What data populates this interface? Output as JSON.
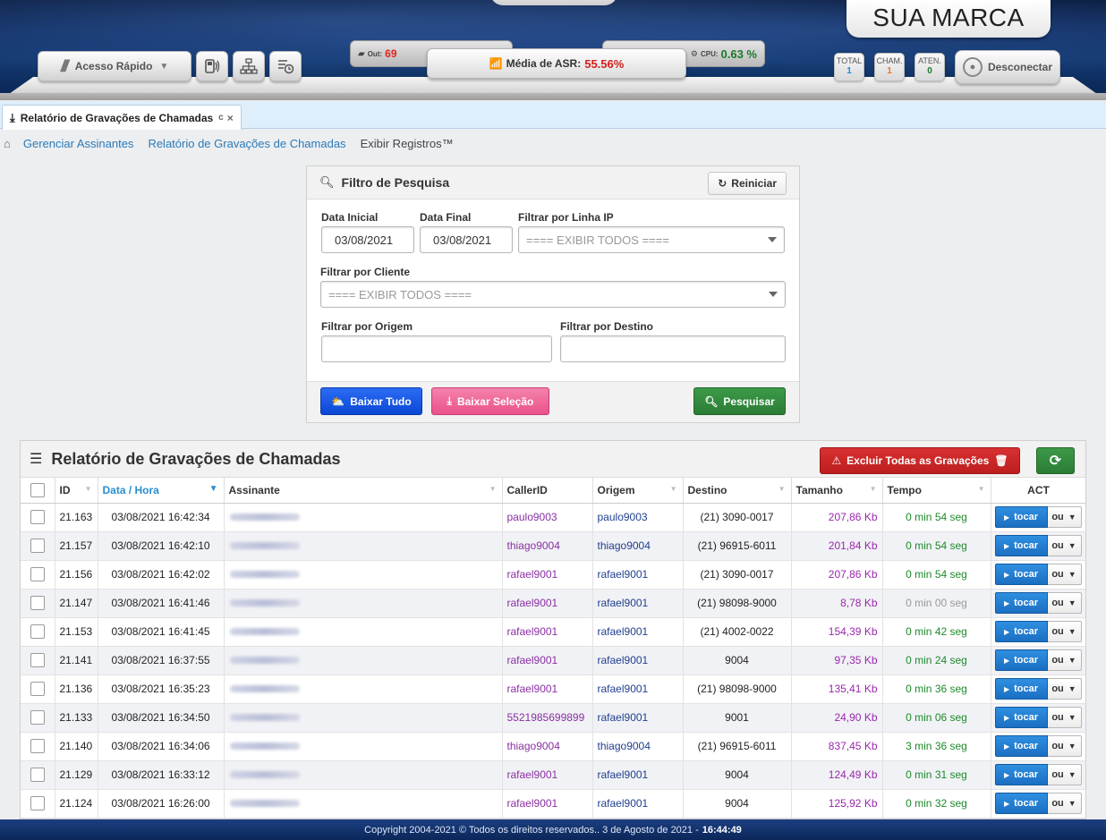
{
  "header": {
    "brand": "SUA MARCA",
    "quick_access": "Acesso Rápido",
    "stat_out_label": "Out:",
    "stat_out_value": "69",
    "asr_label": "Média de ASR:",
    "asr_value": "55.56%",
    "cpu_label": "CPU:",
    "cpu_value": "0.63 %",
    "counters": [
      {
        "label": "TOTAL",
        "value": "1"
      },
      {
        "label": "CHAM.",
        "value": "1"
      },
      {
        "label": "ATEN.",
        "value": "0"
      }
    ],
    "logout": "Desconectar"
  },
  "tab": {
    "label": "Relatório de Gravações de Chamadas",
    "refresh": "c",
    "close": "×"
  },
  "breadcrumb": {
    "items": [
      "Gerenciar Assinantes",
      "Relatório de Gravações de Chamadas"
    ],
    "current": "Exibir Registros™"
  },
  "filter": {
    "title": "Filtro de Pesquisa",
    "reset": "Reiniciar",
    "date_start_label": "Data Inicial",
    "date_start_value": "03/08/2021",
    "date_end_label": "Data Final",
    "date_end_value": "03/08/2021",
    "ip_line_label": "Filtrar por Linha IP",
    "ip_line_value": "==== EXIBIR TODOS ====",
    "client_label": "Filtrar por Cliente",
    "client_value": "==== EXIBIR TODOS ====",
    "origin_label": "Filtrar por Origem",
    "origin_value": "",
    "dest_label": "Filtrar por Destino",
    "dest_value": "",
    "download_all": "Baixar Tudo",
    "download_selection": "Baixar Seleção",
    "search": "Pesquisar"
  },
  "report": {
    "title": "Relatório de Gravações de Chamadas",
    "delete_all": "Excluir Todas as Gravações",
    "columns": {
      "id": "ID",
      "datetime": "Data / Hora",
      "subscriber": "Assinante",
      "callerid": "CallerID",
      "origin": "Origem",
      "destination": "Destino",
      "size": "Tamanho",
      "time": "Tempo",
      "act": "ACT"
    },
    "play_label": "tocar",
    "or_label": "ou",
    "rows": [
      {
        "id": "21.163",
        "datetime": "03/08/2021 16:42:34",
        "callerid": "paulo9003",
        "origin": "paulo9003",
        "destination": "(21) 3090-0017",
        "size": "207,86 Kb",
        "time": "0 min 54 seg"
      },
      {
        "id": "21.157",
        "datetime": "03/08/2021 16:42:10",
        "callerid": "thiago9004",
        "origin": "thiago9004",
        "destination": "(21) 96915-6011",
        "size": "201,84 Kb",
        "time": "0 min 54 seg"
      },
      {
        "id": "21.156",
        "datetime": "03/08/2021 16:42:02",
        "callerid": "rafael9001",
        "origin": "rafael9001",
        "destination": "(21) 3090-0017",
        "size": "207,86 Kb",
        "time": "0 min 54 seg"
      },
      {
        "id": "21.147",
        "datetime": "03/08/2021 16:41:46",
        "callerid": "rafael9001",
        "origin": "rafael9001",
        "destination": "(21) 98098-9000",
        "size": "8,78 Kb",
        "time": "0 min 00 seg"
      },
      {
        "id": "21.153",
        "datetime": "03/08/2021 16:41:45",
        "callerid": "rafael9001",
        "origin": "rafael9001",
        "destination": "(21) 4002-0022",
        "size": "154,39 Kb",
        "time": "0 min 42 seg"
      },
      {
        "id": "21.141",
        "datetime": "03/08/2021 16:37:55",
        "callerid": "rafael9001",
        "origin": "rafael9001",
        "destination": "9004",
        "size": "97,35 Kb",
        "time": "0 min 24 seg"
      },
      {
        "id": "21.136",
        "datetime": "03/08/2021 16:35:23",
        "callerid": "rafael9001",
        "origin": "rafael9001",
        "destination": "(21) 98098-9000",
        "size": "135,41 Kb",
        "time": "0 min 36 seg"
      },
      {
        "id": "21.133",
        "datetime": "03/08/2021 16:34:50",
        "callerid": "5521985699899",
        "origin": "rafael9001",
        "destination": "9001",
        "size": "24,90 Kb",
        "time": "0 min 06 seg"
      },
      {
        "id": "21.140",
        "datetime": "03/08/2021 16:34:06",
        "callerid": "thiago9004",
        "origin": "thiago9004",
        "destination": "(21) 96915-6011",
        "size": "837,45 Kb",
        "time": "3 min 36 seg"
      },
      {
        "id": "21.129",
        "datetime": "03/08/2021 16:33:12",
        "callerid": "rafael9001",
        "origin": "rafael9001",
        "destination": "9004",
        "size": "124,49 Kb",
        "time": "0 min 31 seg"
      },
      {
        "id": "21.124",
        "datetime": "03/08/2021 16:26:00",
        "callerid": "rafael9001",
        "origin": "rafael9001",
        "destination": "9004",
        "size": "125,92 Kb",
        "time": "0 min 32 seg"
      }
    ]
  },
  "footer": {
    "text": "Copyright 2004-2021 © Todos os direitos reservados.. 3 de Agosto de 2021 -",
    "time": "16:44:49"
  },
  "colors": {
    "accent_blue": "#2a8fd0",
    "danger": "#d93131",
    "success": "#2b7d35",
    "pink": "#e9528a",
    "primary": "#0b47d4"
  }
}
